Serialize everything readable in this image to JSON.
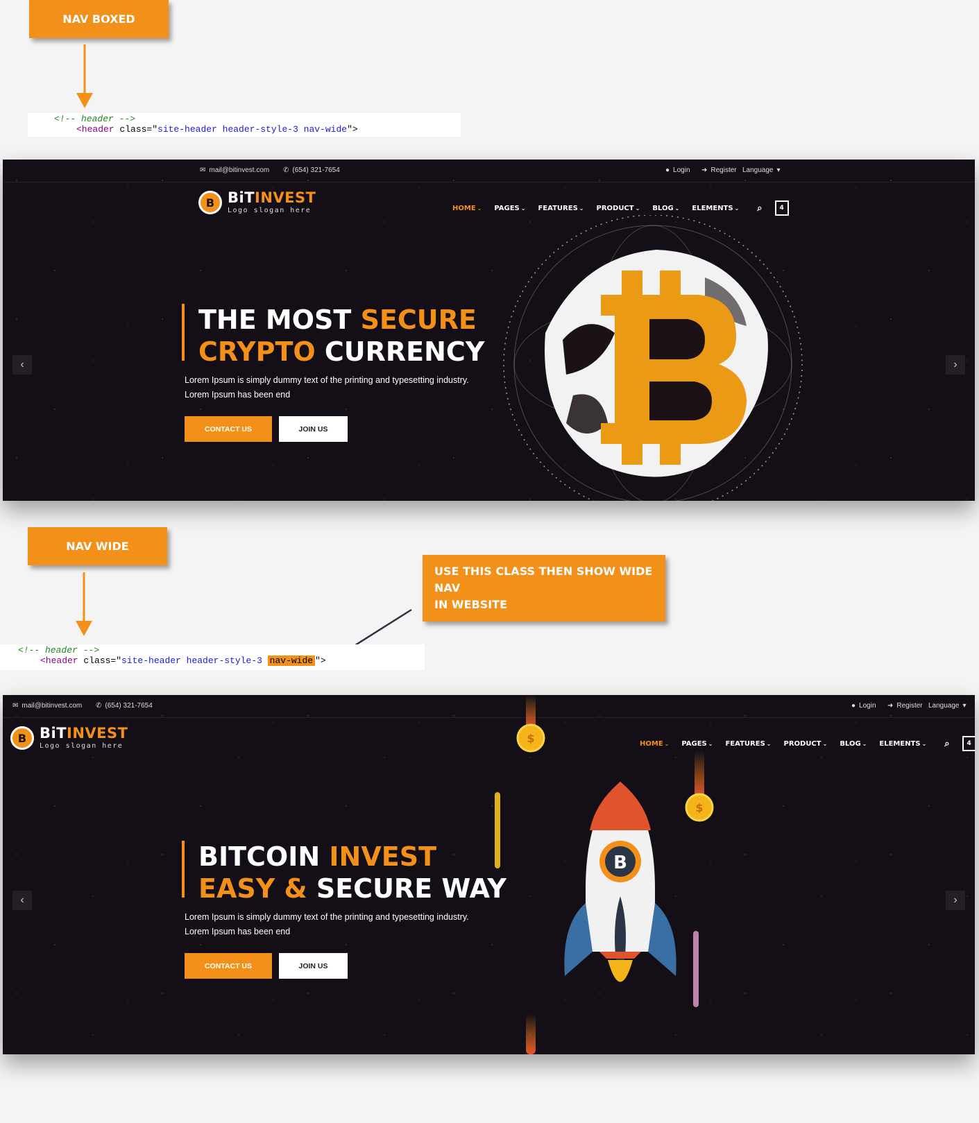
{
  "callouts": {
    "boxed": "NAV BOXED",
    "wide": "NAV WIDE",
    "note_line1": "USE THIS CLASS THEN SHOW WIDE NAV",
    "note_line2": "IN WEBSITE"
  },
  "code": {
    "comment": "<!-- header -->",
    "tag_open": "<header",
    "attr": " class=\"",
    "value": "site-header header-style-3 ",
    "highlight": "nav-wide",
    "close": "\">"
  },
  "topbar": {
    "email": "mail@bitinvest.com",
    "phone": "(654) 321-7654",
    "login": "Login",
    "register": "Register",
    "language": "Language"
  },
  "logo": {
    "name_white": "BiT",
    "name_orange": "INVEST",
    "slogan": "Logo slogan here",
    "coin_letter": "B"
  },
  "nav": {
    "items": [
      "HOME",
      "PAGES",
      "FEATURES",
      "PRODUCT",
      "BLOG",
      "ELEMENTS"
    ],
    "cart_count": "4"
  },
  "hero1": {
    "line1_white": "THE MOST ",
    "line1_orange": "SECURE",
    "line2_orange": "CRYPTO",
    "line2_white": " CURRENCY",
    "desc": "Lorem Ipsum is simply dummy text of the printing and typesetting industry. Lorem Ipsum has been end",
    "btn_contact": "CONTACT US",
    "btn_join": "JOIN US"
  },
  "hero2": {
    "line1_white": "BITCOIN ",
    "line1_orange": "INVEST",
    "line2_orange": "EASY & ",
    "line2_white": " SECURE WAY",
    "desc": "Lorem Ipsum is simply dummy text of the printing and typesetting industry. Lorem Ipsum has been end",
    "btn_contact": "CONTACT US",
    "btn_join": "JOIN US"
  },
  "icons": {
    "prev": "‹",
    "next": "›",
    "search": "⌕",
    "coin": "$"
  },
  "colors": {
    "accent": "#f39019",
    "dark_bg": "#140f17"
  }
}
